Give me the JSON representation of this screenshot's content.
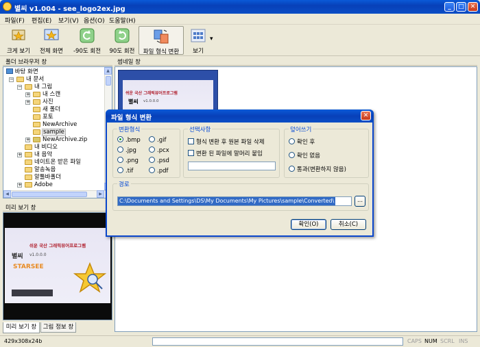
{
  "window": {
    "title": "별씨 v1.004 - see_logo2ex.jpg",
    "min": "_",
    "max": "□",
    "close": "✕"
  },
  "menu": [
    "파일(F)",
    "편집(E)",
    "보기(V)",
    "옵션(O)",
    "도움말(H)"
  ],
  "toolbar": {
    "items": [
      {
        "label": "크게 보기",
        "icon": "zoom-view-icon"
      },
      {
        "label": "전체 화면",
        "icon": "fullscreen-icon"
      },
      {
        "label": "-90도 회전",
        "icon": "rotate-left-icon"
      },
      {
        "label": "90도 회전",
        "icon": "rotate-right-icon"
      },
      {
        "label": "파일 형식 변환",
        "icon": "convert-format-icon",
        "active": true
      },
      {
        "label": "보기",
        "icon": "view-mode-icon"
      }
    ],
    "dropdown_arrow": "▾"
  },
  "folder_pane": {
    "header": "폴더 브라우저 창",
    "nodes": [
      {
        "label": "바탕 화면",
        "level": 0,
        "expander": "",
        "icon": "desktop"
      },
      {
        "label": "내 문서",
        "level": 1,
        "expander": "−",
        "icon": "folder"
      },
      {
        "label": "내 그림",
        "level": 2,
        "expander": "−",
        "icon": "folder-open"
      },
      {
        "label": "내 스캔",
        "level": 3,
        "expander": "+",
        "icon": "folder"
      },
      {
        "label": "사진",
        "level": 3,
        "expander": "+",
        "icon": "folder"
      },
      {
        "label": "새 폴더",
        "level": 3,
        "expander": "",
        "icon": "folder"
      },
      {
        "label": "포토",
        "level": 3,
        "expander": "",
        "icon": "folder"
      },
      {
        "label": "NewArchive",
        "level": 3,
        "expander": "",
        "icon": "folder"
      },
      {
        "label": "sample",
        "level": 3,
        "expander": "",
        "icon": "folder-open"
      },
      {
        "label": "NewArchive.zip",
        "level": 3,
        "expander": "+",
        "icon": "zip"
      },
      {
        "label": "내 비디오",
        "level": 2,
        "expander": "",
        "icon": "folder"
      },
      {
        "label": "내 음악",
        "level": 2,
        "expander": "+",
        "icon": "folder"
      },
      {
        "label": "네이트온 받은 파일",
        "level": 2,
        "expander": "",
        "icon": "folder"
      },
      {
        "label": "알송녹음",
        "level": 2,
        "expander": "",
        "icon": "folder"
      },
      {
        "label": "알툴바폴더",
        "level": 2,
        "expander": "",
        "icon": "folder"
      },
      {
        "label": "Adobe",
        "level": 2,
        "expander": "+",
        "icon": "folder"
      }
    ]
  },
  "preview_pane": {
    "header": "미리 보기 창",
    "tabs": [
      "미리 보기 창",
      "그림 정보 창"
    ],
    "image": {
      "tagline": "쉬운 국산 그래픽뷰어프로그램",
      "name": "별씨",
      "version": "v1.0.0.0",
      "brand": "STARSEE"
    }
  },
  "thumbnail_pane": {
    "header": "썸네일 창",
    "card": {
      "tagline": "쉬운 국산 그래픽뷰어프로그램",
      "name": "별씨",
      "version": "v1.0.0.0"
    }
  },
  "dialog": {
    "title": "파일 형식 변환",
    "close": "✕",
    "format_group": {
      "label": "변환형식",
      "options": [
        ".bmp",
        ".gif",
        ".jpg",
        ".pcx",
        ".png",
        ".psd",
        ".tif",
        ".pdf"
      ],
      "selected": ".bmp"
    },
    "options_group": {
      "label": "선택사항",
      "checks": [
        "형식 변환 후 원본 파일 삭제",
        "변환 된 파일에 말머리 붙임"
      ],
      "prefix_value": ""
    },
    "overwrite_group": {
      "label": "덮어쓰기",
      "options": [
        "확인 후",
        "확인 없음",
        "통과(변환하지 않음)"
      ],
      "selected": ""
    },
    "path_group": {
      "label": "경로",
      "value": "C:\\Documents and Settings\\DS\\My Documents\\My Pictures\\sample\\Converted\\",
      "browse": "..."
    },
    "ok": "확인(O)",
    "cancel": "취소(C)"
  },
  "status": {
    "dims": "429x308x24b",
    "caps": "CAPS",
    "num": "NUM",
    "scrl": "SCRL",
    "ins": "INS"
  },
  "colors": {
    "titlebar": "#0a4ec6",
    "accent": "#0046d5",
    "selection": "#316ac5",
    "folder": "#f5d57b"
  }
}
